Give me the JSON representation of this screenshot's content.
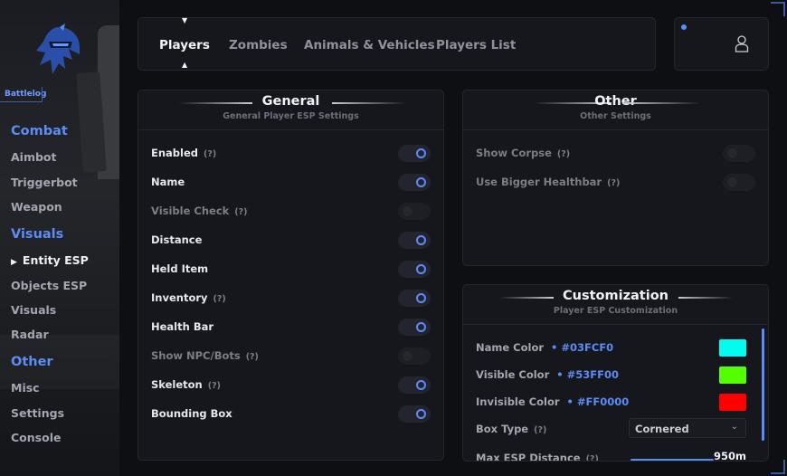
{
  "brand": "Battlelog",
  "sidebar": {
    "sections": [
      {
        "label": "Combat",
        "items": [
          "Aimbot",
          "Triggerbot",
          "Weapon"
        ]
      },
      {
        "label": "Visuals",
        "items": [
          "Entity ESP",
          "Objects ESP",
          "Visuals",
          "Radar"
        ]
      },
      {
        "label": "Other",
        "items": [
          "Misc",
          "Settings",
          "Console"
        ]
      }
    ],
    "active_item": "Entity ESP"
  },
  "tabs": [
    "Players",
    "Zombies",
    "Animals & Vehicles",
    "Players List"
  ],
  "active_tab": "Players",
  "general": {
    "title": "General",
    "subtitle": "General Player ESP Settings",
    "hint": "(?)",
    "rows": [
      {
        "label": "Enabled",
        "hint": true,
        "on": true,
        "disabled": false
      },
      {
        "label": "Name",
        "hint": false,
        "on": true,
        "disabled": false
      },
      {
        "label": "Visible Check",
        "hint": true,
        "on": false,
        "disabled": true
      },
      {
        "label": "Distance",
        "hint": false,
        "on": true,
        "disabled": false
      },
      {
        "label": "Held Item",
        "hint": false,
        "on": true,
        "disabled": false
      },
      {
        "label": "Inventory",
        "hint": true,
        "on": true,
        "disabled": false
      },
      {
        "label": "Health Bar",
        "hint": false,
        "on": true,
        "disabled": false
      },
      {
        "label": "Show NPC/Bots",
        "hint": true,
        "on": false,
        "disabled": true
      },
      {
        "label": "Skeleton",
        "hint": true,
        "on": true,
        "disabled": false
      },
      {
        "label": "Bounding Box",
        "hint": false,
        "on": true,
        "disabled": false
      }
    ]
  },
  "other": {
    "title": "Other",
    "subtitle": "Other Settings",
    "rows": [
      {
        "label": "Show Corpse",
        "hint": true,
        "on": false,
        "disabled": true
      },
      {
        "label": "Use Bigger Healthbar",
        "hint": true,
        "on": false,
        "disabled": true
      }
    ]
  },
  "customization": {
    "title": "Customization",
    "subtitle": "Player ESP Customization",
    "colors": [
      {
        "label": "Name Color",
        "hex": "#03FCF0",
        "swatch": "#03fcf0"
      },
      {
        "label": "Visible Color",
        "hex": "#53FF00",
        "swatch": "#53ff00"
      },
      {
        "label": "Invisible Color",
        "hex": "#FF0000",
        "swatch": "#ff0000"
      }
    ],
    "box_type": {
      "label": "Box Type",
      "hint": "(?)",
      "value": "Cornered"
    },
    "max_distance": {
      "label": "Max ESP Distance",
      "hint": "(?)",
      "value": "950m"
    }
  },
  "accent_color": "#5b8cf5"
}
